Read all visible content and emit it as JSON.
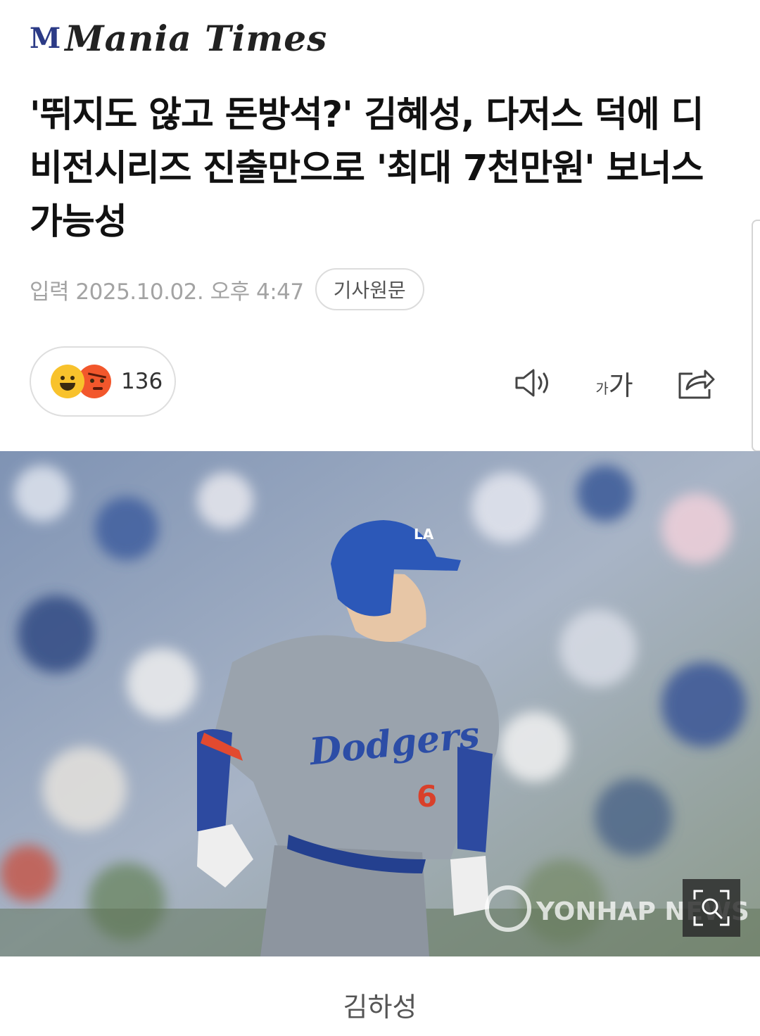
{
  "header": {
    "logo_mark": "M",
    "logo_text": "Mania Times"
  },
  "article": {
    "title": "'뛰지도 않고 돈방석?' 김혜성, 다저스 덕에 디비전시리즈 진출만으로 '최대 7천만원' 보너스 가능성",
    "date": "입력 2025.10.02. 오후 4:47",
    "original_button": "기사원문",
    "reaction_count": "136",
    "font_small": "가",
    "font_big": "가",
    "photo": {
      "jersey_text": "Dodgers",
      "jersey_number": "6",
      "helmet_logo": "LA",
      "watermark": "YONHAP NEWS"
    },
    "caption": "김하성"
  },
  "icons": {
    "speaker": "speaker-icon",
    "font_size": "font-size-icon",
    "share": "share-icon",
    "zoom": "zoom-icon"
  },
  "colors": {
    "logo_blue": "#2b3a86",
    "happy_emoji": "#f8c22c",
    "angry_emoji": "#f2572c"
  }
}
